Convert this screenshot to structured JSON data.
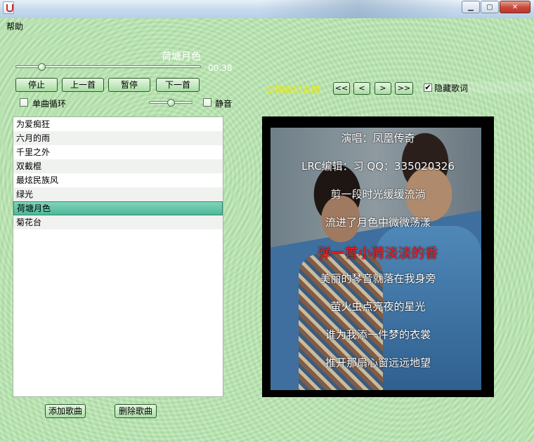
{
  "window": {
    "title_controls": {
      "minimize": "▁",
      "maximize": "▢",
      "close": "✕"
    }
  },
  "menu": {
    "help": "帮助"
  },
  "player": {
    "song_title": "荷塘月色",
    "time": "00:38",
    "progress_fraction": 0.14,
    "volume_fraction": 0.5,
    "buttons": {
      "stop": "停止",
      "prev": "上一首",
      "pause": "暂停",
      "next": "下一首"
    },
    "single_loop_label": "单曲循环",
    "single_loop_checked": false,
    "mute_label": "静音",
    "mute_checked": false
  },
  "lyrics_controls": {
    "adjust_label": "调整歌词进度",
    "buttons": {
      "rewind_fast": "<<",
      "rewind": "<",
      "forward": ">",
      "forward_fast": ">>"
    },
    "hide_label": "隐藏歌词",
    "hide_checked": true,
    "check_mark": "✔"
  },
  "playlist": {
    "items": [
      "为爱痴狂",
      "六月的雨",
      "千里之外",
      "双截棍",
      "最炫民族风",
      "绿光",
      "荷塘月色",
      "菊花台"
    ],
    "selected_index": 6,
    "add_label": "添加歌曲",
    "delete_label": "删除歌曲"
  },
  "lyrics": {
    "lines": [
      "演唱：凤凰传奇",
      "LRC编辑：习 QQ：335020326",
      "剪一段时光缓缓流淌",
      "流进了月色中微微荡漾",
      "弹一首小荷淡淡的香",
      "美丽的琴音就落在我身旁",
      "萤火虫点亮夜的星光",
      "谁为我添一件梦的衣裳",
      "推开那扇心窗远远地望"
    ],
    "current_index": 4
  },
  "colors": {
    "background": "#b8e6b0",
    "lyric_current": "#ff1a1a",
    "lyric_normal": "#ffffff",
    "adjust_label": "#e8e800",
    "selected_row": "#4fb89a"
  }
}
